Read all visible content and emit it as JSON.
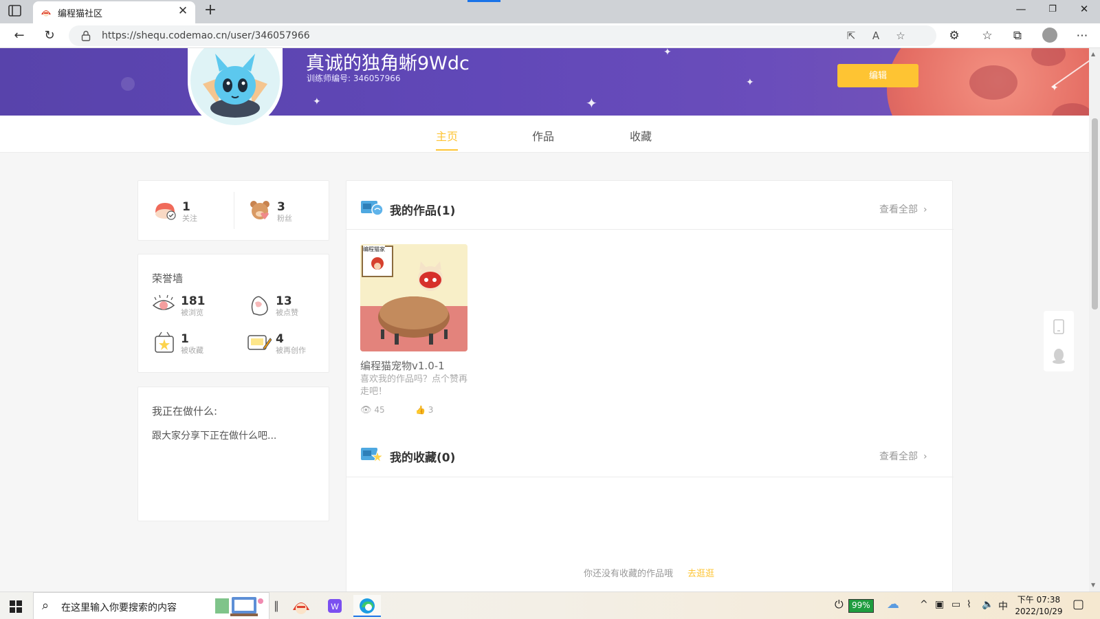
{
  "browser": {
    "tab_title": "编程猫社区",
    "url": "https://shequ.codemao.cn/user/346057966",
    "close_tab": "✕",
    "new_tab": "+"
  },
  "profile": {
    "username": "真诚的独角蜥9Wdc",
    "trainer_id": "训练师编号: 346057966",
    "edit_label": "编辑"
  },
  "tabs": [
    {
      "label": "主页",
      "active": true
    },
    {
      "label": "作品",
      "active": false
    },
    {
      "label": "收藏",
      "active": false
    }
  ],
  "follow": {
    "following_count": "1",
    "following_label": "关注",
    "fans_count": "3",
    "fans_label": "粉丝"
  },
  "honor": {
    "title": "荣誉墙",
    "items": [
      {
        "value": "181",
        "label": "被浏览"
      },
      {
        "value": "13",
        "label": "被点赞"
      },
      {
        "value": "1",
        "label": "被收藏"
      },
      {
        "value": "4",
        "label": "被再创作"
      }
    ]
  },
  "status": {
    "title": "我正在做什么:",
    "text": "跟大家分享下正在做什么吧..."
  },
  "my_works": {
    "title": "我的作品(1)",
    "see_all": "查看全部",
    "items": [
      {
        "name": "编程猫宠物v1.0-1",
        "desc": "喜欢我的作品吗？点个赞再走吧！",
        "views": "45",
        "likes": "3",
        "thumb_label": "编程猫家"
      }
    ]
  },
  "my_collections": {
    "title": "我的收藏(0)",
    "see_all": "查看全部",
    "empty_text": "你还没有收藏的作品哦",
    "empty_link": "去逛逛"
  },
  "taskbar": {
    "search_placeholder": "在这里输入你要搜索的内容",
    "battery": "99%",
    "ime": "中",
    "time": "下午 07:38",
    "date": "2022/10/29"
  },
  "colors": {
    "accent": "#fec433",
    "banner": "#5d45b2",
    "planet": "#e56e64"
  }
}
